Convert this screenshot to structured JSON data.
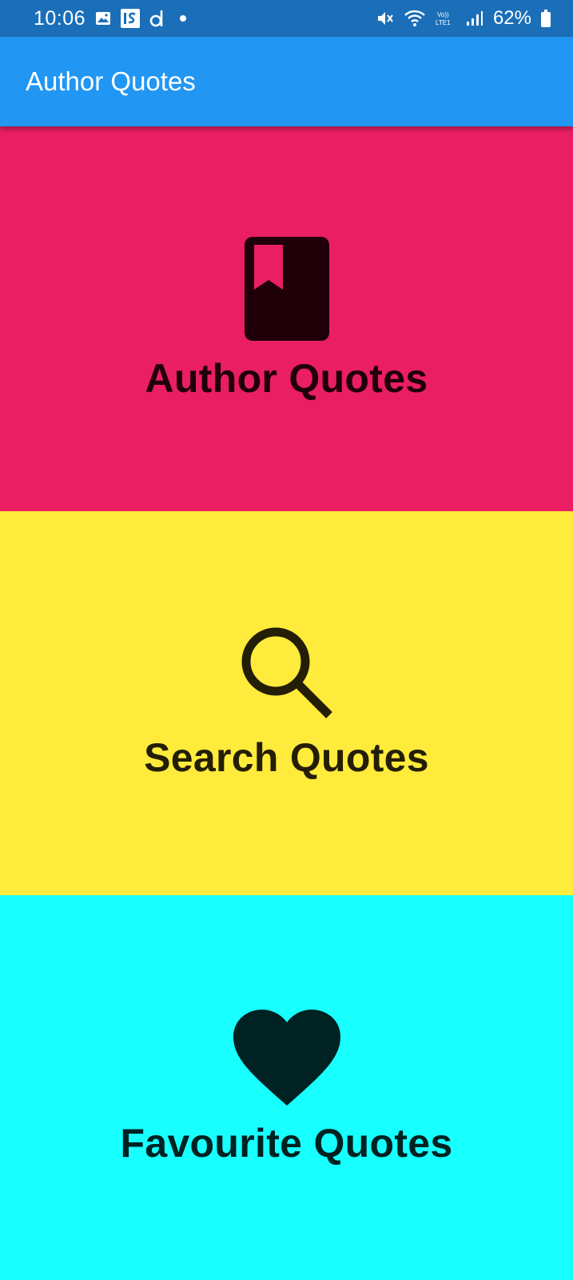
{
  "status_bar": {
    "time": "10:06",
    "battery": "62%",
    "icons": [
      "gallery-icon",
      "is-app-icon",
      "d-app-icon",
      "notification-dot-icon",
      "mute-icon",
      "wifi-icon",
      "volte-icon",
      "signal-icon",
      "battery-icon"
    ],
    "color": "#1b6fb8"
  },
  "app_bar": {
    "title": "Author Quotes",
    "color": "#2196f3"
  },
  "tiles": [
    {
      "label": "Author Quotes",
      "icon": "book-icon",
      "bg": "#e91e63",
      "fg": "#200008"
    },
    {
      "label": "Search Quotes",
      "icon": "search-icon",
      "bg": "#ffeb3b",
      "fg": "#241e06"
    },
    {
      "label": "Favourite Quotes",
      "icon": "heart-icon",
      "bg": "#18ffff",
      "fg": "#002222"
    }
  ]
}
